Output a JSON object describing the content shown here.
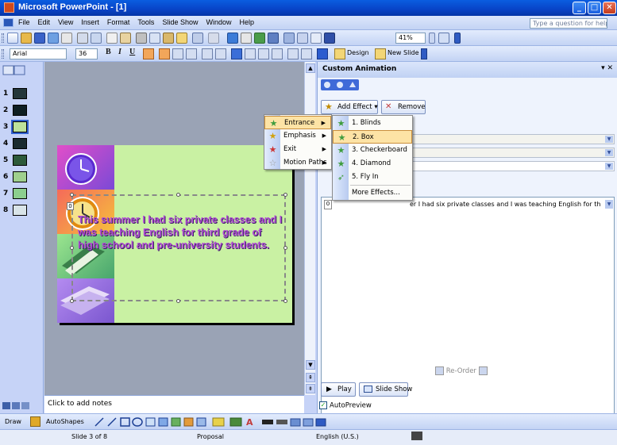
{
  "window": {
    "title": "Microsoft PowerPoint - [1]"
  },
  "menubar": {
    "items": [
      "File",
      "Edit",
      "View",
      "Insert",
      "Format",
      "Tools",
      "Slide Show",
      "Window",
      "Help"
    ],
    "help_placeholder": "Type a question for help"
  },
  "toolbar": {
    "zoom": "41%",
    "font": "Arial",
    "size": "36",
    "design_label": "Design",
    "new_slide_label": "New Slide"
  },
  "thumbnails": {
    "numbers": [
      "1",
      "2",
      "3",
      "4",
      "5",
      "6",
      "7",
      "8"
    ],
    "selected": "3"
  },
  "slide": {
    "text": "This summer I had six private classes and I was teaching English for third grade of high school and pre-university students.",
    "tag": "0"
  },
  "notes": {
    "placeholder": "Click to add notes"
  },
  "taskpane": {
    "title": "Custom Animation",
    "add_effect": "Add Effect",
    "remove": "Remove",
    "anim_index": "0",
    "anim_text": "er I had six private classes and I was teaching English for third ...",
    "reorder": "Re-Order",
    "play": "Play",
    "slideshow": "Slide Show",
    "autopreview": "AutoPreview"
  },
  "effect_menu": {
    "items": [
      "Entrance",
      "Emphasis",
      "Exit",
      "Motion Paths"
    ]
  },
  "entrance_menu": {
    "items": [
      "1. Blinds",
      "2. Box",
      "3. Checkerboard",
      "4. Diamond",
      "5. Fly In"
    ],
    "more": "More Effects..."
  },
  "drawbar": {
    "draw": "Draw",
    "autoshapes": "AutoShapes"
  },
  "status": {
    "slide": "Slide 3 of 8",
    "design": "Proposal",
    "language": "English (U.S.)"
  }
}
